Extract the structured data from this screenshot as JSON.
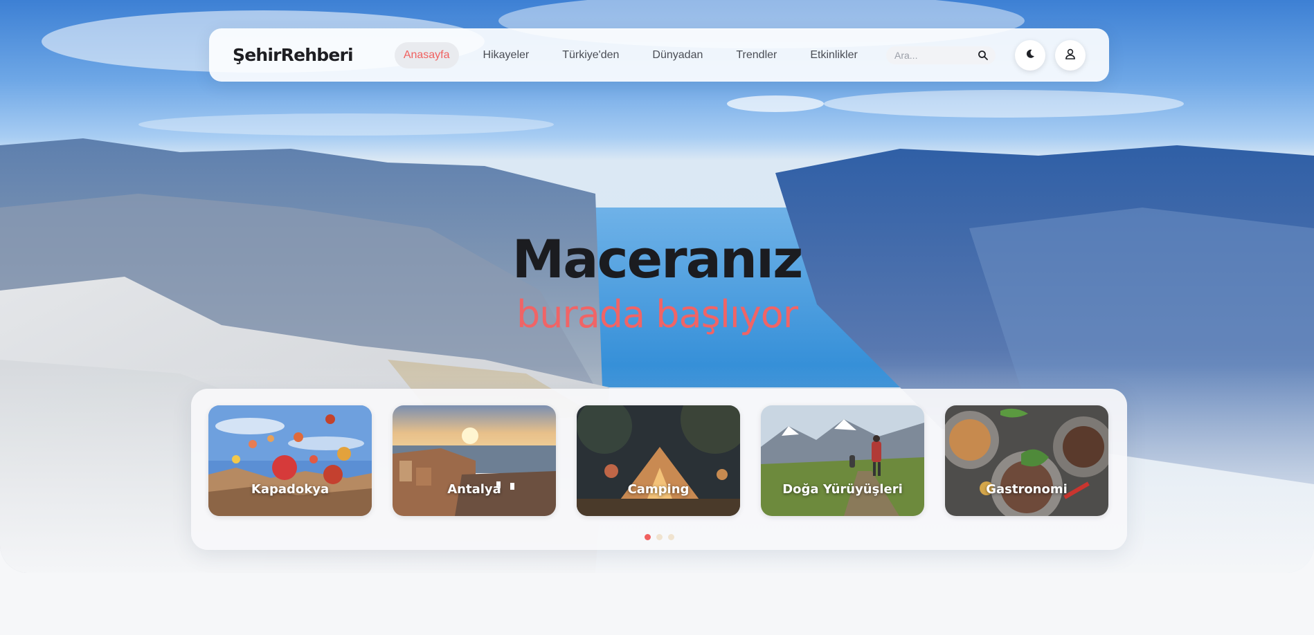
{
  "nav": {
    "logo": "ŞehirRehberi",
    "items": [
      {
        "label": "Anasayfa",
        "active": true
      },
      {
        "label": "Hikayeler",
        "active": false
      },
      {
        "label": "Türkiye'den",
        "active": false
      },
      {
        "label": "Dünyadan",
        "active": false
      },
      {
        "label": "Trendler",
        "active": false
      },
      {
        "label": "Etkinlikler",
        "active": false
      }
    ],
    "search": {
      "placeholder": "Ara...",
      "value": "",
      "icon": "search-icon"
    },
    "theme_toggle_icon": "moon-icon",
    "user_icon": "user-icon"
  },
  "hero": {
    "title": "Maceranız",
    "subtitle": "burada başlıyor"
  },
  "carousel": {
    "cards": [
      {
        "label": "Kapadokya"
      },
      {
        "label": "Antalya"
      },
      {
        "label": "Camping"
      },
      {
        "label": "Doğa Yürüyüşleri"
      },
      {
        "label": "Gastronomi"
      }
    ],
    "pages": 3,
    "active_page": 1
  },
  "colors": {
    "accent": "#f0605f",
    "dot_inactive": "#f0e3cf",
    "text_dark": "#1b1c20"
  }
}
